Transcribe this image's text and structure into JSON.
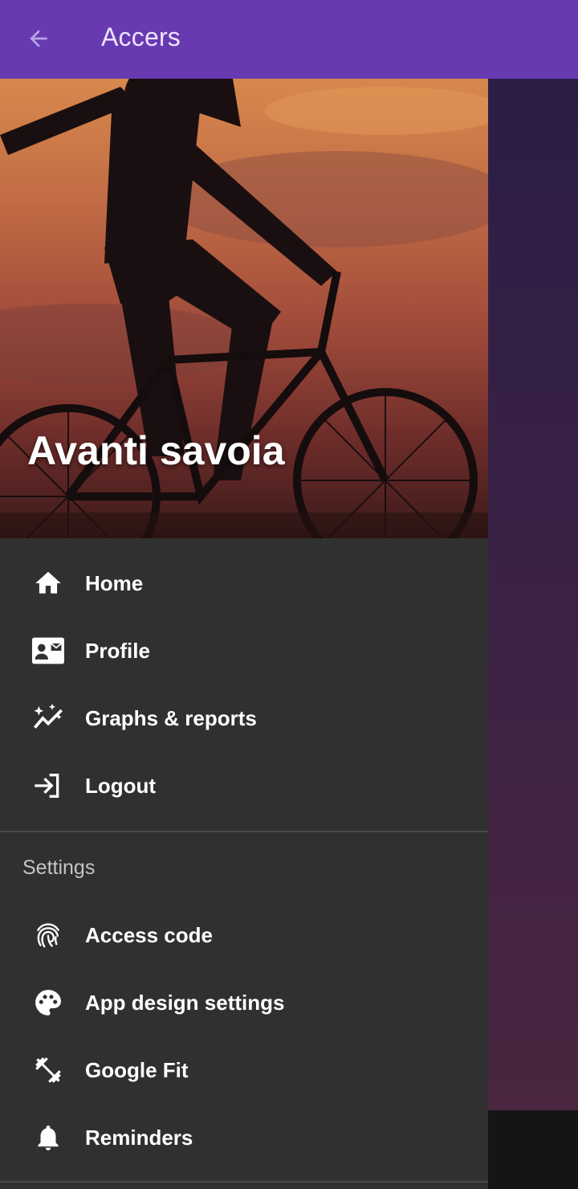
{
  "app_bar": {
    "title": "Accers",
    "back_icon": "arrow-back-icon",
    "color": "#673AB1"
  },
  "drawer": {
    "header": {
      "user_name": "Avanti savoia"
    },
    "main_items": [
      {
        "label": "Home",
        "icon": "home-icon"
      },
      {
        "label": "Profile",
        "icon": "contact-card-icon"
      },
      {
        "label": "Graphs & reports",
        "icon": "sparkle-chart-icon"
      },
      {
        "label": "Logout",
        "icon": "logout-icon"
      }
    ],
    "settings_header": "Settings",
    "settings_items": [
      {
        "label": "Access code",
        "icon": "fingerprint-icon"
      },
      {
        "label": "App design settings",
        "icon": "palette-icon"
      },
      {
        "label": "Google Fit",
        "icon": "fitness-icon"
      },
      {
        "label": "Reminders",
        "icon": "bell-icon"
      }
    ]
  }
}
